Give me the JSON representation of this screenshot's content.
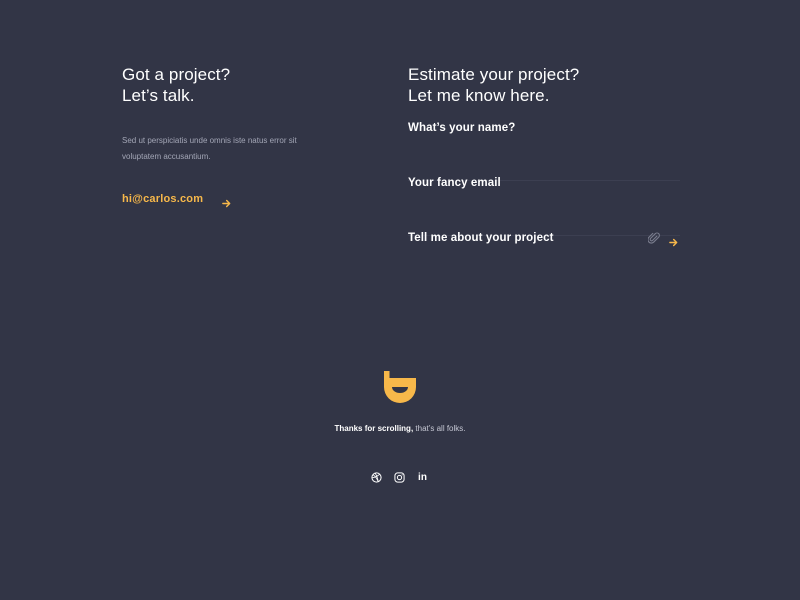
{
  "contact": {
    "headline_line1": "Got a project?",
    "headline_line2": "Let’s talk.",
    "intro": "Sed ut perspiciatis unde omnis iste natus error sit voluptatem accusantium.",
    "email": "hi@carlos.com",
    "arrow_icon": "arrow-right-icon"
  },
  "estimate": {
    "headline_line1": "Estimate your project?",
    "headline_line2": "Let me know here.",
    "fields": [
      {
        "label": "What’s your name?"
      },
      {
        "label": "Your fancy email"
      },
      {
        "label": "Tell me about your project"
      }
    ],
    "attach_icon": "paperclip-icon",
    "submit_icon": "arrow-right-icon"
  },
  "footer": {
    "logo_icon": "smile-logo",
    "thanks_bold": "Thanks for scrolling,",
    "thanks_rest": " that’s all folks.",
    "socials": [
      {
        "name": "dribbble-icon"
      },
      {
        "name": "instagram-icon"
      },
      {
        "name": "linkedin-icon",
        "text": "in"
      }
    ]
  },
  "colors": {
    "background": "#323546",
    "accent": "#f7b84a",
    "text": "#ffffff",
    "muted": "#a3a6b6",
    "divider": "#3c3f51"
  }
}
